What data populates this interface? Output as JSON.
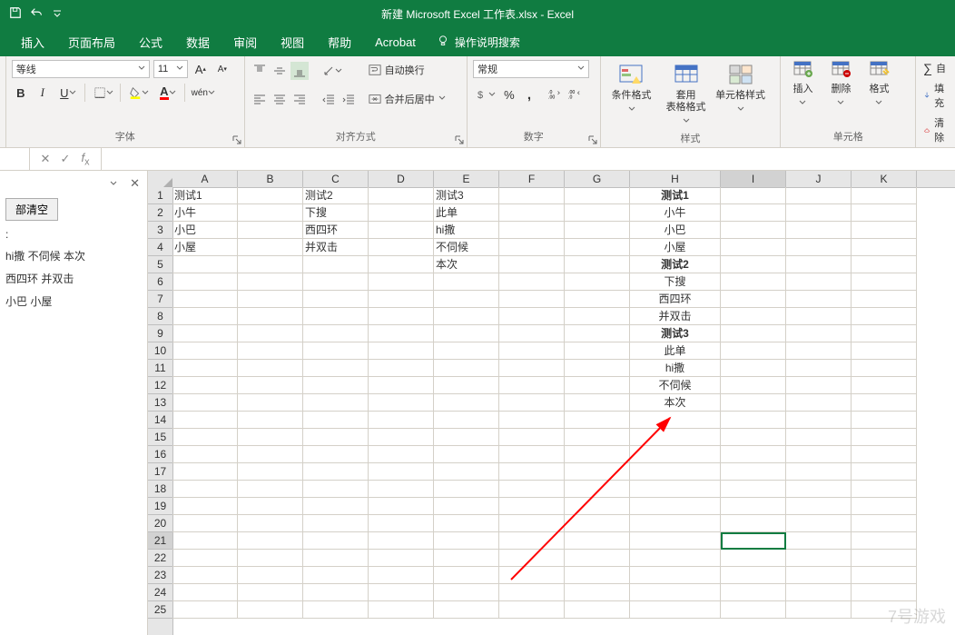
{
  "title": "新建 Microsoft Excel 工作表.xlsx  -  Excel",
  "ribbon_tabs": [
    "插入",
    "页面布局",
    "公式",
    "数据",
    "审阅",
    "视图",
    "帮助",
    "Acrobat"
  ],
  "tell_me": "操作说明搜索",
  "font": {
    "name": "等线",
    "size": "11",
    "bold": "B",
    "italic": "I",
    "underline": "U",
    "phonetic": "wén",
    "grow": "A",
    "shrink": "A"
  },
  "groups": {
    "font": "字体",
    "alignment": "对齐方式",
    "wrap": "自动换行",
    "merge": "合并后居中",
    "number": "数字",
    "number_format": "常规",
    "styles": "样式",
    "cells": "单元格",
    "editing_autosum": "自",
    "editing_fill": "填充",
    "editing_clear": "清除"
  },
  "style_buttons": {
    "cond": "条件格式",
    "table": "套用\n表格格式",
    "cell": "单元格样式"
  },
  "cell_buttons": {
    "insert": "插入",
    "delete": "删除",
    "format": "格式"
  },
  "side": {
    "clear_all": "部清空",
    "history_label": ":",
    "items": [
      "hi撒 不伺候 本次",
      "西四环 并双击",
      "小巴 小屋"
    ]
  },
  "columns": [
    "A",
    "B",
    "C",
    "D",
    "E",
    "F",
    "G",
    "H",
    "I",
    "J",
    "K"
  ],
  "rows_count": 25,
  "grid": {
    "1": {
      "A": "测试1",
      "C": "测试2",
      "E": "测试3",
      "H": {
        "v": "测试1",
        "b": true
      }
    },
    "2": {
      "A": "小牛",
      "C": "下搜",
      "E": "此单",
      "H": "小牛"
    },
    "3": {
      "A": "小巴",
      "C": "西四环",
      "E": "hi撒",
      "H": "小巴"
    },
    "4": {
      "A": "小屋",
      "C": "并双击",
      "E": "不伺候",
      "H": "小屋"
    },
    "5": {
      "E": "本次",
      "H": {
        "v": "测试2",
        "b": true
      }
    },
    "6": {
      "H": "下搜"
    },
    "7": {
      "H": "西四环"
    },
    "8": {
      "H": "并双击"
    },
    "9": {
      "H": {
        "v": "测试3",
        "b": true
      }
    },
    "10": {
      "H": "此单"
    },
    "11": {
      "H": "hi撒"
    },
    "12": {
      "H": "不伺候"
    },
    "13": {
      "H": "本次"
    }
  },
  "selected": {
    "row": 21,
    "col": "I"
  },
  "watermark": "7号游戏"
}
